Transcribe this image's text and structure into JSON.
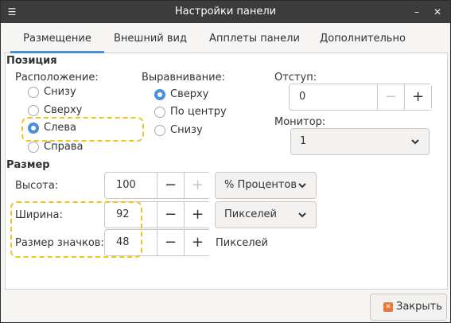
{
  "window": {
    "title": "Настройки панели"
  },
  "tabs": [
    {
      "label": "Размещение",
      "active": true
    },
    {
      "label": "Внешний вид"
    },
    {
      "label": "Апплеты панели"
    },
    {
      "label": "Дополнительно"
    }
  ],
  "position": {
    "heading": "Позиция",
    "placement_label": "Расположение:",
    "placement_options": [
      "Снизу",
      "Сверху",
      "Слева",
      "Справа"
    ],
    "placement_selected": "Слева",
    "align_label": "Выравнивание:",
    "align_options": [
      "Сверху",
      "По центру",
      "Снизу"
    ],
    "align_selected": "Сверху",
    "offset_label": "Отступ:",
    "offset_value": "0",
    "monitor_label": "Монитор:",
    "monitor_value": "1"
  },
  "size": {
    "heading": "Размер",
    "height_label": "Высота:",
    "height_value": "100",
    "height_unit": "% Процентов",
    "width_label": "Ширина:",
    "width_value": "92",
    "width_unit": "Пикселей",
    "icon_label": "Размер значков:",
    "icon_value": "48",
    "icon_unit": "Пикселей"
  },
  "spin": {
    "minus": "−",
    "plus": "+"
  },
  "footer": {
    "close_label": "Закрыть"
  },
  "colors": {
    "accent": "#4a90d9",
    "highlight": "#f0c419",
    "titlebar": "#3c3c3c"
  }
}
